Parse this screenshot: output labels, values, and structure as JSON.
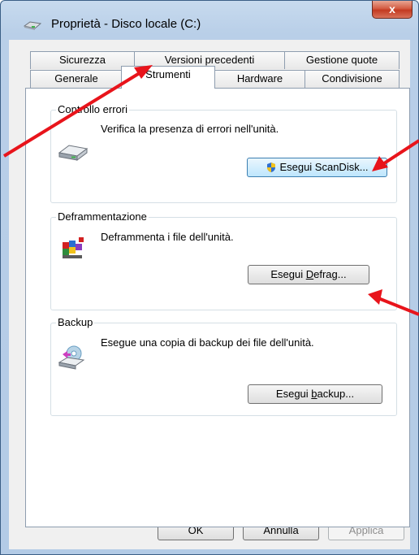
{
  "window": {
    "title": "Proprietà - Disco locale (C:)",
    "close_label": "x"
  },
  "tabs_row1": [
    {
      "label": "Sicurezza"
    },
    {
      "label": "Versioni precedenti"
    },
    {
      "label": "Gestione quote"
    }
  ],
  "tabs_row2": [
    {
      "label": "Generale"
    },
    {
      "label": "Strumenti"
    },
    {
      "label": "Hardware"
    },
    {
      "label": "Condivisione"
    }
  ],
  "error_check": {
    "group_label": "Controllo errori",
    "description": "Verifica la presenza di errori nell'unità.",
    "button_label": "Esegui ScanDisk..."
  },
  "defrag": {
    "group_label": "Deframmentazione",
    "description": "Deframmenta i file dell'unità.",
    "button_pre": "Esegui ",
    "button_accel": "D",
    "button_post": "efrag..."
  },
  "backup": {
    "group_label": "Backup",
    "description": "Esegue una copia di backup dei file dell'unità.",
    "button_pre": "Esegui ",
    "button_accel": "b",
    "button_post": "ackup..."
  },
  "footer": {
    "ok_label": "OK",
    "cancel_label": "Annulla",
    "apply_label": "Applica"
  },
  "colors": {
    "annotation_arrow": "#e8141b"
  }
}
